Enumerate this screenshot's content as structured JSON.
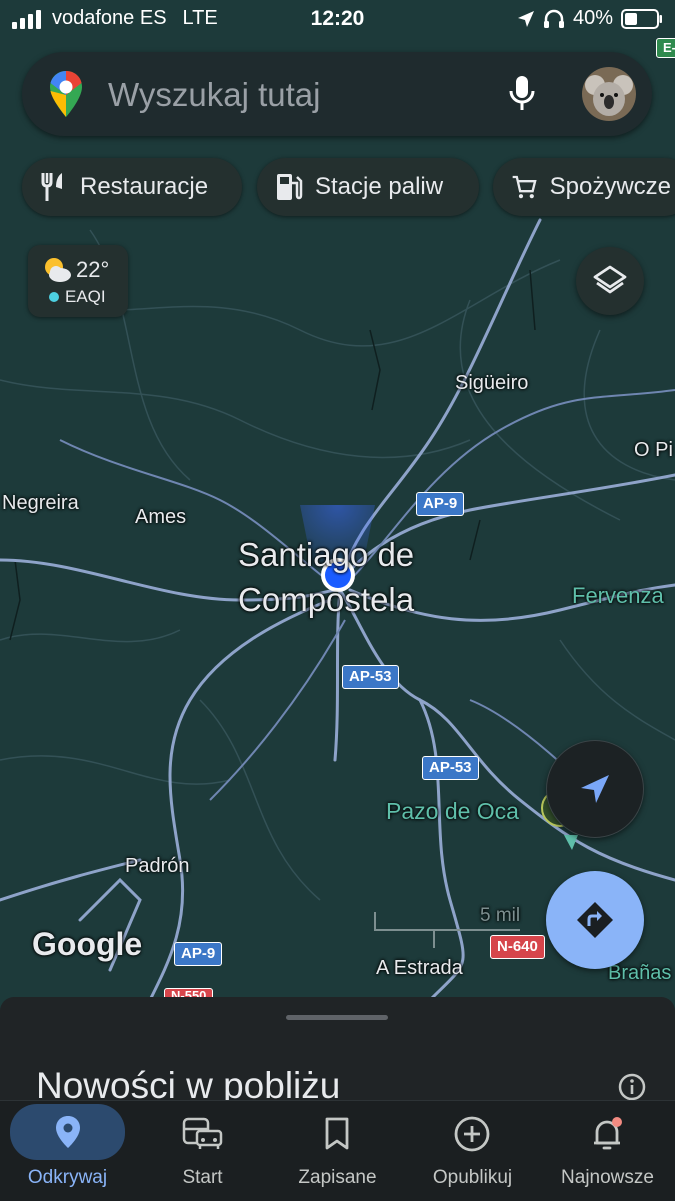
{
  "status_bar": {
    "carrier": "vodafone ES",
    "network": "LTE",
    "time": "12:20",
    "battery": "40%"
  },
  "search": {
    "placeholder": "Wyszukaj tutaj"
  },
  "chips": [
    {
      "label": "Restauracje",
      "icon": "fork-knife-icon"
    },
    {
      "label": "Stacje paliw",
      "icon": "gas-station-icon"
    },
    {
      "label": "Spożywcze",
      "icon": "cart-icon"
    }
  ],
  "weather": {
    "temperature": "22°",
    "aqi_label": "EAQI"
  },
  "map": {
    "places": {
      "sigueiro": "Sigüeiro",
      "o_pino": "O Pi",
      "negreira": "Negreira",
      "ames": "Ames",
      "santiago_line1": "Santiago de",
      "santiago_line2": "Compostela",
      "fervenza": "Fervenza",
      "pazo_de_oca": "Pazo de Oca",
      "padron": "Padrón",
      "a_estrada": "A Estrada",
      "branas": "Brañas"
    },
    "road_shields": {
      "ap9_top": "AP-9",
      "ap53_a": "AP-53",
      "ap53_b": "AP-53",
      "ap9_bottom": "AP-9",
      "n640": "N-640",
      "n550": "N-550",
      "corner": "E-"
    },
    "scale": "5 mil",
    "logo": "Google"
  },
  "colors": {
    "map_bg": "#1d3a3a",
    "road": "#8ea3c9",
    "location_dot": "#1a5cff",
    "directions_button": "#8ab4f8",
    "active_tab": "#8ab4f8",
    "highway_shield": "#3b77c7",
    "national_shield": "#d6454b"
  },
  "bottom_sheet": {
    "title": "Nowości w pobliżu"
  },
  "tabs": [
    {
      "label": "Odkrywaj",
      "icon": "location-pin-icon",
      "active": true
    },
    {
      "label": "Start",
      "icon": "car-transit-icon",
      "active": false
    },
    {
      "label": "Zapisane",
      "icon": "bookmark-icon",
      "active": false
    },
    {
      "label": "Opublikuj",
      "icon": "add-circle-icon",
      "active": false
    },
    {
      "label": "Najnowsze",
      "icon": "bell-icon",
      "active": false
    }
  ]
}
